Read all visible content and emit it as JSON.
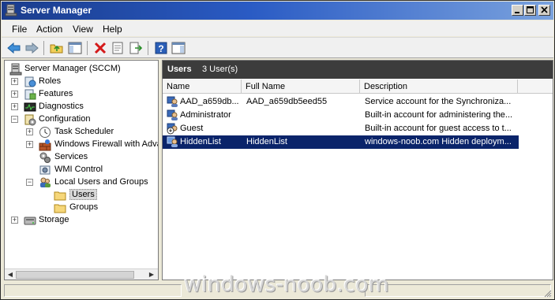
{
  "window": {
    "title": "Server Manager"
  },
  "menu": [
    "File",
    "Action",
    "View",
    "Help"
  ],
  "toolbar": {
    "icons": [
      "back-icon",
      "forward-icon",
      "up-folder-icon",
      "show-hide-tree-icon",
      "delete-icon",
      "properties-icon",
      "export-icon",
      "help-icon",
      "action-pane-icon"
    ]
  },
  "tree": {
    "root": "Server Manager (SCCM)",
    "roles": "Roles",
    "features": "Features",
    "diagnostics": "Diagnostics",
    "configuration": "Configuration",
    "task_scheduler": "Task Scheduler",
    "firewall": "Windows Firewall with Adva",
    "services": "Services",
    "wmi": "WMI Control",
    "local_users_groups": "Local Users and Groups",
    "users": "Users",
    "groups": "Groups",
    "storage": "Storage"
  },
  "list": {
    "header_title": "Users",
    "header_count": "3 User(s)",
    "columns": [
      "Name",
      "Full Name",
      "Description"
    ],
    "rows": [
      {
        "name": "AAD_a659db...",
        "full_name": "AAD_a659db5eed55",
        "description": "Service account for the Synchroniza..."
      },
      {
        "name": "Administrator",
        "full_name": "",
        "description": "Built-in account for administering the..."
      },
      {
        "name": "Guest",
        "full_name": "",
        "description": "Built-in account for guest access to t..."
      },
      {
        "name": "HiddenList",
        "full_name": "HiddenList",
        "description": "windows-noob.com Hidden deploym..."
      }
    ]
  },
  "watermark": "windows-noob.com",
  "colors": {
    "title_bar": "#1a3c8c",
    "header_band": "#3c3c3c",
    "selection": "#0a246a"
  }
}
